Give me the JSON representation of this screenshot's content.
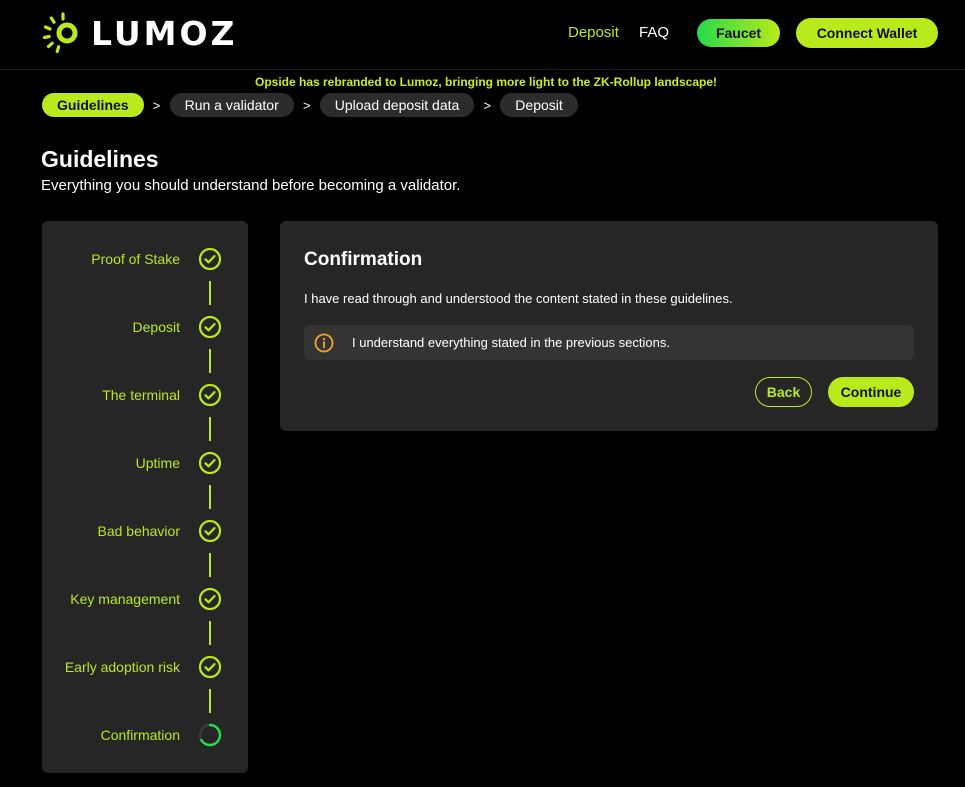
{
  "header": {
    "logo_text": "LUMOZ",
    "nav": {
      "deposit": "Deposit",
      "faq": "FAQ"
    },
    "faucet_label": "Faucet",
    "connect_label": "Connect Wallet"
  },
  "announcement": "Opside has rebranded to Lumoz, bringing more light to the ZK-Rollup landscape!",
  "breadcrumbs": [
    "Guidelines",
    "Run a validator",
    "Upload deposit data",
    "Deposit"
  ],
  "breadcrumb_separator": ">",
  "page": {
    "title": "Guidelines",
    "subtitle": "Everything you should understand before becoming a validator."
  },
  "steps": [
    {
      "label": "Proof of Stake",
      "status": "complete"
    },
    {
      "label": "Deposit",
      "status": "complete"
    },
    {
      "label": "The terminal",
      "status": "complete"
    },
    {
      "label": "Uptime",
      "status": "complete"
    },
    {
      "label": "Bad behavior",
      "status": "complete"
    },
    {
      "label": "Key management",
      "status": "complete"
    },
    {
      "label": "Early adoption risk",
      "status": "complete"
    },
    {
      "label": "Confirmation",
      "status": "in-progress"
    }
  ],
  "card": {
    "title": "Confirmation",
    "text": "I have read through and understood the content stated in these guidelines.",
    "notice": "I understand everything stated in the previous sections.",
    "back_label": "Back",
    "continue_label": "Continue"
  },
  "colors": {
    "accent": "#b9ea1c",
    "accent_green": "#28d94a",
    "panel": "#262626",
    "notice_icon": "#f5a524",
    "background": "#000000"
  },
  "icons": {
    "step_complete": "check-circle-icon",
    "step_in_progress": "spinner-icon",
    "notice": "info-icon"
  }
}
